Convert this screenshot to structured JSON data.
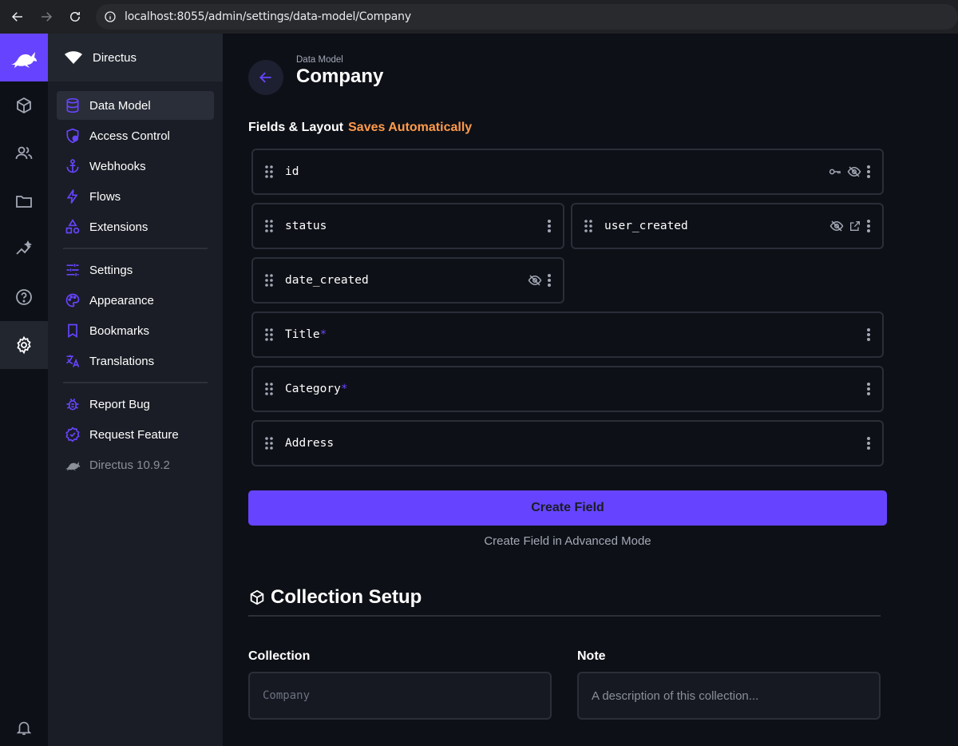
{
  "browser": {
    "url": "localhost:8055/admin/settings/data-model/Company"
  },
  "sidebar": {
    "project_name": "Directus",
    "items": [
      {
        "label": "Data Model",
        "icon": "database-icon",
        "active": true
      },
      {
        "label": "Access Control",
        "icon": "shield-user-icon"
      },
      {
        "label": "Webhooks",
        "icon": "anchor-icon"
      },
      {
        "label": "Flows",
        "icon": "bolt-icon"
      },
      {
        "label": "Extensions",
        "icon": "shapes-icon"
      },
      {
        "label": "Settings",
        "icon": "sliders-icon"
      },
      {
        "label": "Appearance",
        "icon": "palette-icon"
      },
      {
        "label": "Bookmarks",
        "icon": "bookmark-icon"
      },
      {
        "label": "Translations",
        "icon": "translate-icon"
      },
      {
        "label": "Report Bug",
        "icon": "bug-icon"
      },
      {
        "label": "Request Feature",
        "icon": "verified-icon"
      },
      {
        "label": "Directus 10.9.2",
        "icon": "directus-rabbit-icon"
      }
    ]
  },
  "header": {
    "breadcrumb": "Data Model",
    "title": "Company"
  },
  "fields_section": {
    "title": "Fields & Layout",
    "saves": "Saves Automatically"
  },
  "fields": [
    {
      "name": "id",
      "required": false,
      "icons": [
        "key-icon",
        "hidden-icon",
        "more-icon"
      ]
    },
    {
      "name": "status",
      "required": false,
      "icons": [
        "more-icon"
      ]
    },
    {
      "name": "user_created",
      "required": false,
      "icons": [
        "hidden-icon",
        "open-in-new-icon",
        "more-icon"
      ]
    },
    {
      "name": "date_created",
      "required": false,
      "icons": [
        "hidden-icon",
        "more-icon"
      ]
    },
    {
      "name": "Title",
      "required": true,
      "icons": [
        "more-icon"
      ]
    },
    {
      "name": "Category",
      "required": true,
      "icons": [
        "more-icon"
      ]
    },
    {
      "name": "Address",
      "required": false,
      "icons": [
        "more-icon"
      ]
    }
  ],
  "required_marker": "*",
  "actions": {
    "create_field": "Create Field",
    "create_advanced": "Create Field in Advanced Mode"
  },
  "setup": {
    "title": "Collection Setup",
    "collection_label": "Collection",
    "collection_value": "Company",
    "note_label": "Note",
    "note_placeholder": "A description of this collection..."
  },
  "colors": {
    "accent": "#6644ff",
    "warning": "#ff9b4a",
    "background": "#0e1017",
    "sidebar": "#1a1d25"
  }
}
